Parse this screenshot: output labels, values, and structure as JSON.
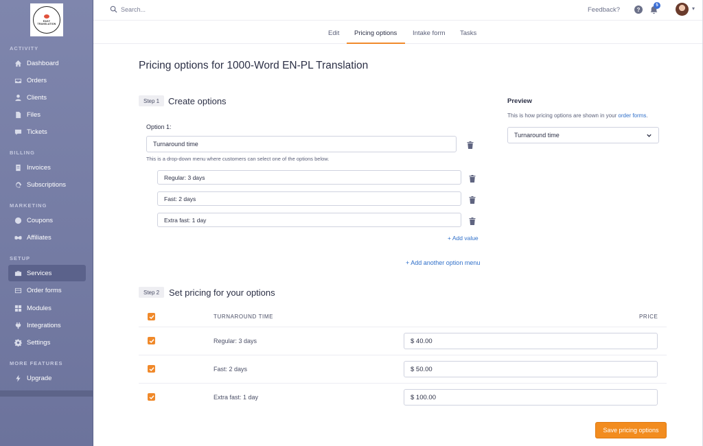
{
  "logo": {
    "line1": "EASY",
    "line2": "TRANSLATION"
  },
  "sidebar": {
    "sections": [
      {
        "label": "ACTIVITY",
        "items": [
          {
            "label": "Dashboard",
            "icon": "home-icon"
          },
          {
            "label": "Orders",
            "icon": "inbox-icon"
          },
          {
            "label": "Clients",
            "icon": "user-icon"
          },
          {
            "label": "Files",
            "icon": "file-icon"
          },
          {
            "label": "Tickets",
            "icon": "chat-icon"
          }
        ]
      },
      {
        "label": "BILLING",
        "items": [
          {
            "label": "Invoices",
            "icon": "invoice-icon"
          },
          {
            "label": "Subscriptions",
            "icon": "refresh-icon"
          }
        ]
      },
      {
        "label": "MARKETING",
        "items": [
          {
            "label": "Coupons",
            "icon": "coupon-icon"
          },
          {
            "label": "Affiliates",
            "icon": "handshake-icon"
          }
        ]
      },
      {
        "label": "SETUP",
        "items": [
          {
            "label": "Services",
            "icon": "briefcase-icon",
            "active": true
          },
          {
            "label": "Order forms",
            "icon": "form-icon"
          },
          {
            "label": "Modules",
            "icon": "grid-icon"
          },
          {
            "label": "Integrations",
            "icon": "plug-icon"
          },
          {
            "label": "Settings",
            "icon": "gear-icon"
          }
        ]
      },
      {
        "label": "MORE FEATURES",
        "items": [
          {
            "label": "Upgrade",
            "icon": "bolt-icon"
          }
        ]
      }
    ]
  },
  "topbar": {
    "search_placeholder": "Search...",
    "feedback": "Feedback?",
    "help": "?",
    "notification_count": "5"
  },
  "tabs": [
    "Edit",
    "Pricing options",
    "Intake form",
    "Tasks"
  ],
  "page": {
    "title": "Pricing options for 1000-Word EN-PL Translation",
    "step1": {
      "tag": "Step 1",
      "title": "Create options"
    },
    "option_label": "Option 1:",
    "option_name": "Turnaround time",
    "help_text": "This is a drop-down menu where customers can select one of the options below.",
    "values": [
      "Regular: 3 days",
      "Fast: 2 days",
      "Extra fast: 1 day"
    ],
    "add_value": "+ Add value",
    "add_option_menu": "+ Add another option menu",
    "step2": {
      "tag": "Step 2",
      "title": "Set pricing for your options"
    },
    "table_headers": {
      "col1": "TURNAROUND TIME",
      "col2": "PRICE"
    },
    "prices": [
      "$ 40.00",
      "$ 50.00",
      "$ 100.00"
    ],
    "save_button": "Save pricing options"
  },
  "preview": {
    "title": "Preview",
    "text_prefix": "This is how pricing options are shown in your ",
    "text_link": "order forms",
    "text_suffix": ".",
    "select_value": "Turnaround time"
  },
  "colors": {
    "accent": "#f28c1f",
    "link": "#2f6fc9",
    "sidebar": "#7f86ad"
  }
}
